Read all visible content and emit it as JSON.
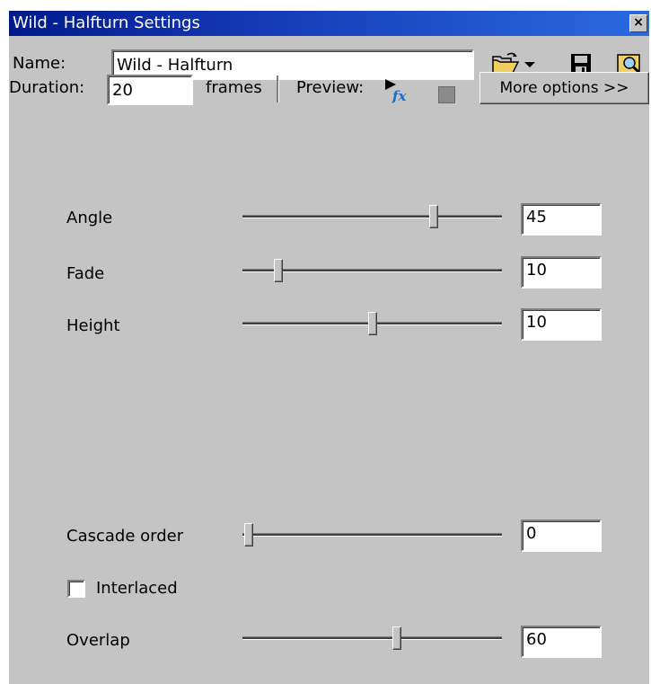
{
  "window": {
    "title": "Wild - Halfturn Settings",
    "close_glyph": "×"
  },
  "name_row": {
    "label": "Name:",
    "value": "Wild - Halfturn"
  },
  "duration_row": {
    "label": "Duration:",
    "value": "20",
    "unit": "frames",
    "preview_label": "Preview:",
    "more_options_label": "More options >>"
  },
  "sliders": [
    {
      "label": "Angle",
      "value": "45",
      "level": 0.75
    },
    {
      "label": "Fade",
      "value": "10",
      "level": 0.12
    },
    {
      "label": "Height",
      "value": "10",
      "level": 0.5
    },
    {
      "label": "Cascade order",
      "value": "0",
      "level": 0.0
    },
    {
      "label": "Overlap",
      "value": "60",
      "level": 0.6
    }
  ],
  "interlaced": {
    "label": "Interlaced",
    "checked": false
  },
  "icons": {
    "open": "open-folder-icon",
    "dropdown": "dropdown-arrow-icon",
    "save": "save-disk-icon",
    "browse": "browse-icon",
    "preview_play": "preview-fx-play-icon",
    "preview_stop": "stop-icon"
  },
  "colors": {
    "window_bg": "#c4c4c4",
    "title_start": "#001a8c",
    "title_end": "#2a6ae0"
  }
}
